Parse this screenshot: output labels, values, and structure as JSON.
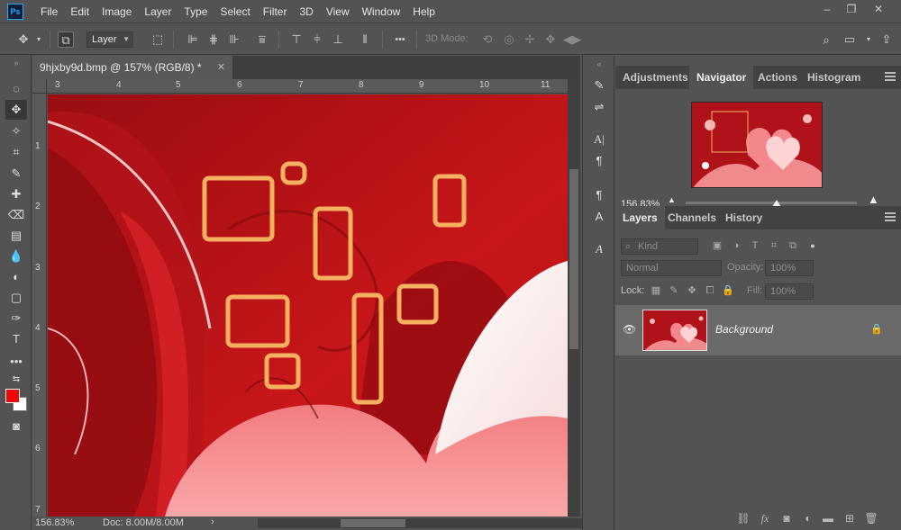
{
  "app": {
    "logo": "Ps"
  },
  "menu": [
    "File",
    "Edit",
    "Image",
    "Layer",
    "Type",
    "Select",
    "Filter",
    "3D",
    "View",
    "Window",
    "Help"
  ],
  "window_controls": {
    "minimize": "–",
    "restore": "❐",
    "close": "✕"
  },
  "options_bar": {
    "layer_dropdown": "Layer",
    "more": "•••",
    "mode_3d_label": "3D Mode:"
  },
  "document": {
    "tab_title": "9hjxby9d.bmp @ 157% (RGB/8) *",
    "close": "✕",
    "zoom_status": "156.83%",
    "doc_info": "Doc: 8.00M/8.00M",
    "arrow": "›"
  },
  "rulers": {
    "horizontal": [
      "3",
      "4",
      "5",
      "6",
      "7",
      "8",
      "9",
      "10",
      "11"
    ],
    "vertical": [
      "1",
      "2",
      "3",
      "4",
      "5",
      "6",
      "7"
    ]
  },
  "panels": {
    "top_tabs": [
      "Adjustments",
      "Navigator",
      "Actions",
      "Histogram"
    ],
    "top_active": "Navigator",
    "navigator_zoom": "156.83%",
    "navigator_zoom_fraction": 0.53,
    "layers_tabs": [
      "Layers",
      "Channels",
      "History"
    ],
    "layers_active": "Layers",
    "kind_placeholder": "Kind",
    "blend_mode": "Normal",
    "opacity_label": "Opacity:",
    "opacity_value": "100%",
    "lock_label": "Lock:",
    "fill_label": "Fill:",
    "fill_value": "100%",
    "layer_name": "Background"
  },
  "colors": {
    "foreground": "#ff0000",
    "background": "#ffffff",
    "highlight_box": "#f5b060"
  }
}
